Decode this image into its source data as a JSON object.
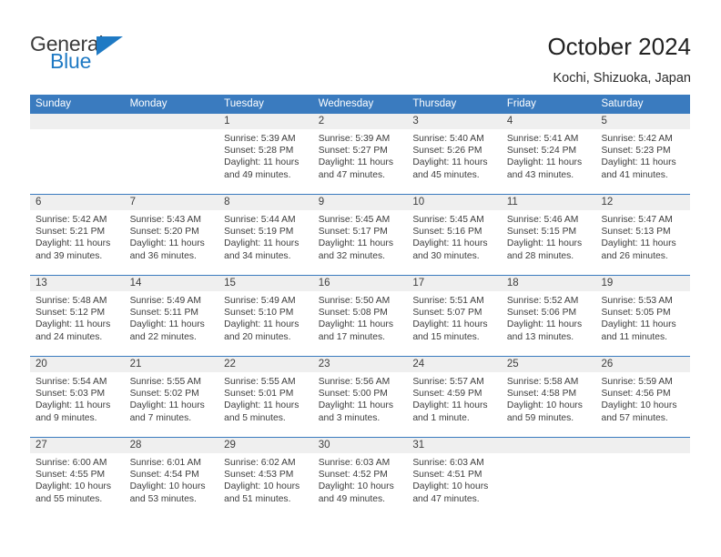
{
  "brand": {
    "name_top": "General",
    "name_bottom": "Blue",
    "color_top": "#3b3b3b",
    "color_bottom": "#1f7ac4",
    "triangle_color": "#1f7ac4"
  },
  "header": {
    "title": "October 2024",
    "subtitle": "Kochi, Shizuoka, Japan"
  },
  "theme": {
    "header_bg": "#3a7bbf",
    "header_text": "#ffffff",
    "daynum_band_bg": "#efefef",
    "cell_text": "#3d3d3d",
    "separator": "#3a7bbf"
  },
  "weekdays": [
    "Sunday",
    "Monday",
    "Tuesday",
    "Wednesday",
    "Thursday",
    "Friday",
    "Saturday"
  ],
  "weeks": [
    [
      {
        "day": "",
        "lines": []
      },
      {
        "day": "",
        "lines": []
      },
      {
        "day": "1",
        "lines": [
          "Sunrise: 5:39 AM",
          "Sunset: 5:28 PM",
          "Daylight: 11 hours",
          "and 49 minutes."
        ]
      },
      {
        "day": "2",
        "lines": [
          "Sunrise: 5:39 AM",
          "Sunset: 5:27 PM",
          "Daylight: 11 hours",
          "and 47 minutes."
        ]
      },
      {
        "day": "3",
        "lines": [
          "Sunrise: 5:40 AM",
          "Sunset: 5:26 PM",
          "Daylight: 11 hours",
          "and 45 minutes."
        ]
      },
      {
        "day": "4",
        "lines": [
          "Sunrise: 5:41 AM",
          "Sunset: 5:24 PM",
          "Daylight: 11 hours",
          "and 43 minutes."
        ]
      },
      {
        "day": "5",
        "lines": [
          "Sunrise: 5:42 AM",
          "Sunset: 5:23 PM",
          "Daylight: 11 hours",
          "and 41 minutes."
        ]
      }
    ],
    [
      {
        "day": "6",
        "lines": [
          "Sunrise: 5:42 AM",
          "Sunset: 5:21 PM",
          "Daylight: 11 hours",
          "and 39 minutes."
        ]
      },
      {
        "day": "7",
        "lines": [
          "Sunrise: 5:43 AM",
          "Sunset: 5:20 PM",
          "Daylight: 11 hours",
          "and 36 minutes."
        ]
      },
      {
        "day": "8",
        "lines": [
          "Sunrise: 5:44 AM",
          "Sunset: 5:19 PM",
          "Daylight: 11 hours",
          "and 34 minutes."
        ]
      },
      {
        "day": "9",
        "lines": [
          "Sunrise: 5:45 AM",
          "Sunset: 5:17 PM",
          "Daylight: 11 hours",
          "and 32 minutes."
        ]
      },
      {
        "day": "10",
        "lines": [
          "Sunrise: 5:45 AM",
          "Sunset: 5:16 PM",
          "Daylight: 11 hours",
          "and 30 minutes."
        ]
      },
      {
        "day": "11",
        "lines": [
          "Sunrise: 5:46 AM",
          "Sunset: 5:15 PM",
          "Daylight: 11 hours",
          "and 28 minutes."
        ]
      },
      {
        "day": "12",
        "lines": [
          "Sunrise: 5:47 AM",
          "Sunset: 5:13 PM",
          "Daylight: 11 hours",
          "and 26 minutes."
        ]
      }
    ],
    [
      {
        "day": "13",
        "lines": [
          "Sunrise: 5:48 AM",
          "Sunset: 5:12 PM",
          "Daylight: 11 hours",
          "and 24 minutes."
        ]
      },
      {
        "day": "14",
        "lines": [
          "Sunrise: 5:49 AM",
          "Sunset: 5:11 PM",
          "Daylight: 11 hours",
          "and 22 minutes."
        ]
      },
      {
        "day": "15",
        "lines": [
          "Sunrise: 5:49 AM",
          "Sunset: 5:10 PM",
          "Daylight: 11 hours",
          "and 20 minutes."
        ]
      },
      {
        "day": "16",
        "lines": [
          "Sunrise: 5:50 AM",
          "Sunset: 5:08 PM",
          "Daylight: 11 hours",
          "and 17 minutes."
        ]
      },
      {
        "day": "17",
        "lines": [
          "Sunrise: 5:51 AM",
          "Sunset: 5:07 PM",
          "Daylight: 11 hours",
          "and 15 minutes."
        ]
      },
      {
        "day": "18",
        "lines": [
          "Sunrise: 5:52 AM",
          "Sunset: 5:06 PM",
          "Daylight: 11 hours",
          "and 13 minutes."
        ]
      },
      {
        "day": "19",
        "lines": [
          "Sunrise: 5:53 AM",
          "Sunset: 5:05 PM",
          "Daylight: 11 hours",
          "and 11 minutes."
        ]
      }
    ],
    [
      {
        "day": "20",
        "lines": [
          "Sunrise: 5:54 AM",
          "Sunset: 5:03 PM",
          "Daylight: 11 hours",
          "and 9 minutes."
        ]
      },
      {
        "day": "21",
        "lines": [
          "Sunrise: 5:55 AM",
          "Sunset: 5:02 PM",
          "Daylight: 11 hours",
          "and 7 minutes."
        ]
      },
      {
        "day": "22",
        "lines": [
          "Sunrise: 5:55 AM",
          "Sunset: 5:01 PM",
          "Daylight: 11 hours",
          "and 5 minutes."
        ]
      },
      {
        "day": "23",
        "lines": [
          "Sunrise: 5:56 AM",
          "Sunset: 5:00 PM",
          "Daylight: 11 hours",
          "and 3 minutes."
        ]
      },
      {
        "day": "24",
        "lines": [
          "Sunrise: 5:57 AM",
          "Sunset: 4:59 PM",
          "Daylight: 11 hours",
          "and 1 minute."
        ]
      },
      {
        "day": "25",
        "lines": [
          "Sunrise: 5:58 AM",
          "Sunset: 4:58 PM",
          "Daylight: 10 hours",
          "and 59 minutes."
        ]
      },
      {
        "day": "26",
        "lines": [
          "Sunrise: 5:59 AM",
          "Sunset: 4:56 PM",
          "Daylight: 10 hours",
          "and 57 minutes."
        ]
      }
    ],
    [
      {
        "day": "27",
        "lines": [
          "Sunrise: 6:00 AM",
          "Sunset: 4:55 PM",
          "Daylight: 10 hours",
          "and 55 minutes."
        ]
      },
      {
        "day": "28",
        "lines": [
          "Sunrise: 6:01 AM",
          "Sunset: 4:54 PM",
          "Daylight: 10 hours",
          "and 53 minutes."
        ]
      },
      {
        "day": "29",
        "lines": [
          "Sunrise: 6:02 AM",
          "Sunset: 4:53 PM",
          "Daylight: 10 hours",
          "and 51 minutes."
        ]
      },
      {
        "day": "30",
        "lines": [
          "Sunrise: 6:03 AM",
          "Sunset: 4:52 PM",
          "Daylight: 10 hours",
          "and 49 minutes."
        ]
      },
      {
        "day": "31",
        "lines": [
          "Sunrise: 6:03 AM",
          "Sunset: 4:51 PM",
          "Daylight: 10 hours",
          "and 47 minutes."
        ]
      },
      {
        "day": "",
        "lines": []
      },
      {
        "day": "",
        "lines": []
      }
    ]
  ]
}
